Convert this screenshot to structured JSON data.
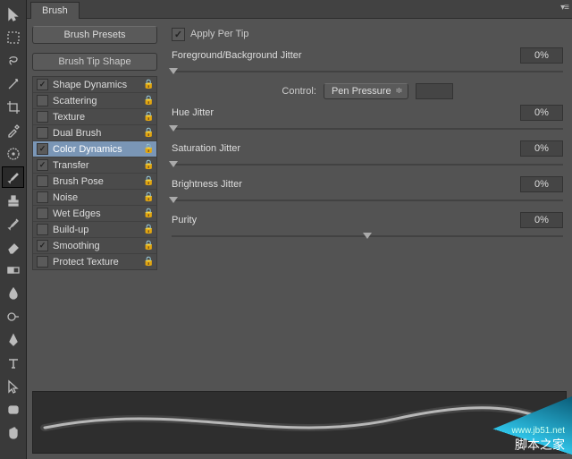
{
  "panel_tab": "Brush",
  "brush_presets_btn": "Brush Presets",
  "tip_shape_header": "Brush Tip Shape",
  "options": [
    {
      "label": "Shape Dynamics",
      "checked": true,
      "locked": true,
      "selected": false
    },
    {
      "label": "Scattering",
      "checked": false,
      "locked": true,
      "selected": false
    },
    {
      "label": "Texture",
      "checked": false,
      "locked": true,
      "selected": false
    },
    {
      "label": "Dual Brush",
      "checked": false,
      "locked": true,
      "selected": false
    },
    {
      "label": "Color Dynamics",
      "checked": true,
      "locked": true,
      "selected": true
    },
    {
      "label": "Transfer",
      "checked": true,
      "locked": true,
      "selected": false
    },
    {
      "label": "Brush Pose",
      "checked": false,
      "locked": true,
      "selected": false
    },
    {
      "label": "Noise",
      "checked": false,
      "locked": true,
      "selected": false
    },
    {
      "label": "Wet Edges",
      "checked": false,
      "locked": true,
      "selected": false
    },
    {
      "label": "Build-up",
      "checked": false,
      "locked": true,
      "selected": false
    },
    {
      "label": "Smoothing",
      "checked": true,
      "locked": true,
      "selected": false
    },
    {
      "label": "Protect Texture",
      "checked": false,
      "locked": true,
      "selected": false
    }
  ],
  "apply_per_tip": {
    "label": "Apply Per Tip",
    "checked": true
  },
  "sliders": {
    "fg_bg_jitter": {
      "label": "Foreground/Background Jitter",
      "value": "0%",
      "pos": 0
    },
    "hue_jitter": {
      "label": "Hue Jitter",
      "value": "0%",
      "pos": 0
    },
    "sat_jitter": {
      "label": "Saturation Jitter",
      "value": "0%",
      "pos": 0
    },
    "bri_jitter": {
      "label": "Brightness Jitter",
      "value": "0%",
      "pos": 0
    },
    "purity": {
      "label": "Purity",
      "value": "0%",
      "pos": 50
    }
  },
  "control": {
    "label": "Control:",
    "value": "Pen Pressure"
  },
  "watermark": {
    "site": "脚本之家",
    "url": "www.jb51.net"
  }
}
